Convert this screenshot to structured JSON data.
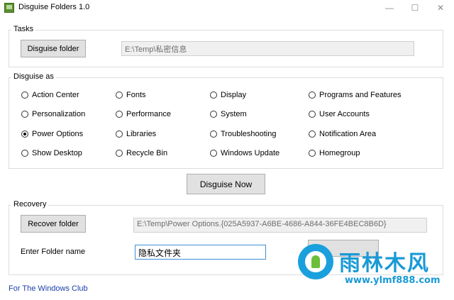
{
  "window": {
    "title": "Disguise Folders 1.0",
    "minimize_glyph": "—",
    "maximize_glyph": "☐",
    "close_glyph": "✕"
  },
  "tasks": {
    "label": "Tasks",
    "disguise_folder_button": "Disguise folder",
    "path_value": "E:\\Temp\\私密信息"
  },
  "disguise_as": {
    "label": "Disguise as",
    "options": [
      {
        "label": "Action Center",
        "checked": false
      },
      {
        "label": "Fonts",
        "checked": false
      },
      {
        "label": "Display",
        "checked": false
      },
      {
        "label": "Programs and Features",
        "checked": false
      },
      {
        "label": "Personalization",
        "checked": false
      },
      {
        "label": "Performance",
        "checked": false
      },
      {
        "label": "System",
        "checked": false
      },
      {
        "label": "User Accounts",
        "checked": false
      },
      {
        "label": "Power Options",
        "checked": true
      },
      {
        "label": "Libraries",
        "checked": false
      },
      {
        "label": "Troubleshooting",
        "checked": false
      },
      {
        "label": "Notification Area",
        "checked": false
      },
      {
        "label": "Show Desktop",
        "checked": false
      },
      {
        "label": "Recycle Bin",
        "checked": false
      },
      {
        "label": "Windows Update",
        "checked": false
      },
      {
        "label": "Homegroup",
        "checked": false
      }
    ]
  },
  "disguise_now_button": "Disguise Now",
  "recovery": {
    "label": "Recovery",
    "recover_folder_button": "Recover folder",
    "path_value": "E:\\Temp\\Power Options.{025A5937-A6BE-4686-A844-36FE4BEC8B6D}",
    "folder_name_label": "Enter Folder name",
    "folder_name_value": "隐私文件夹"
  },
  "footer_link": "For The Windows Club",
  "watermark": {
    "title": "雨林木风",
    "url": "www.ylmf888.com"
  },
  "colors": {
    "accent_link": "#1a3fa8",
    "watermark_blue": "#1a9ad6",
    "input_focus": "#3d8fd6"
  }
}
